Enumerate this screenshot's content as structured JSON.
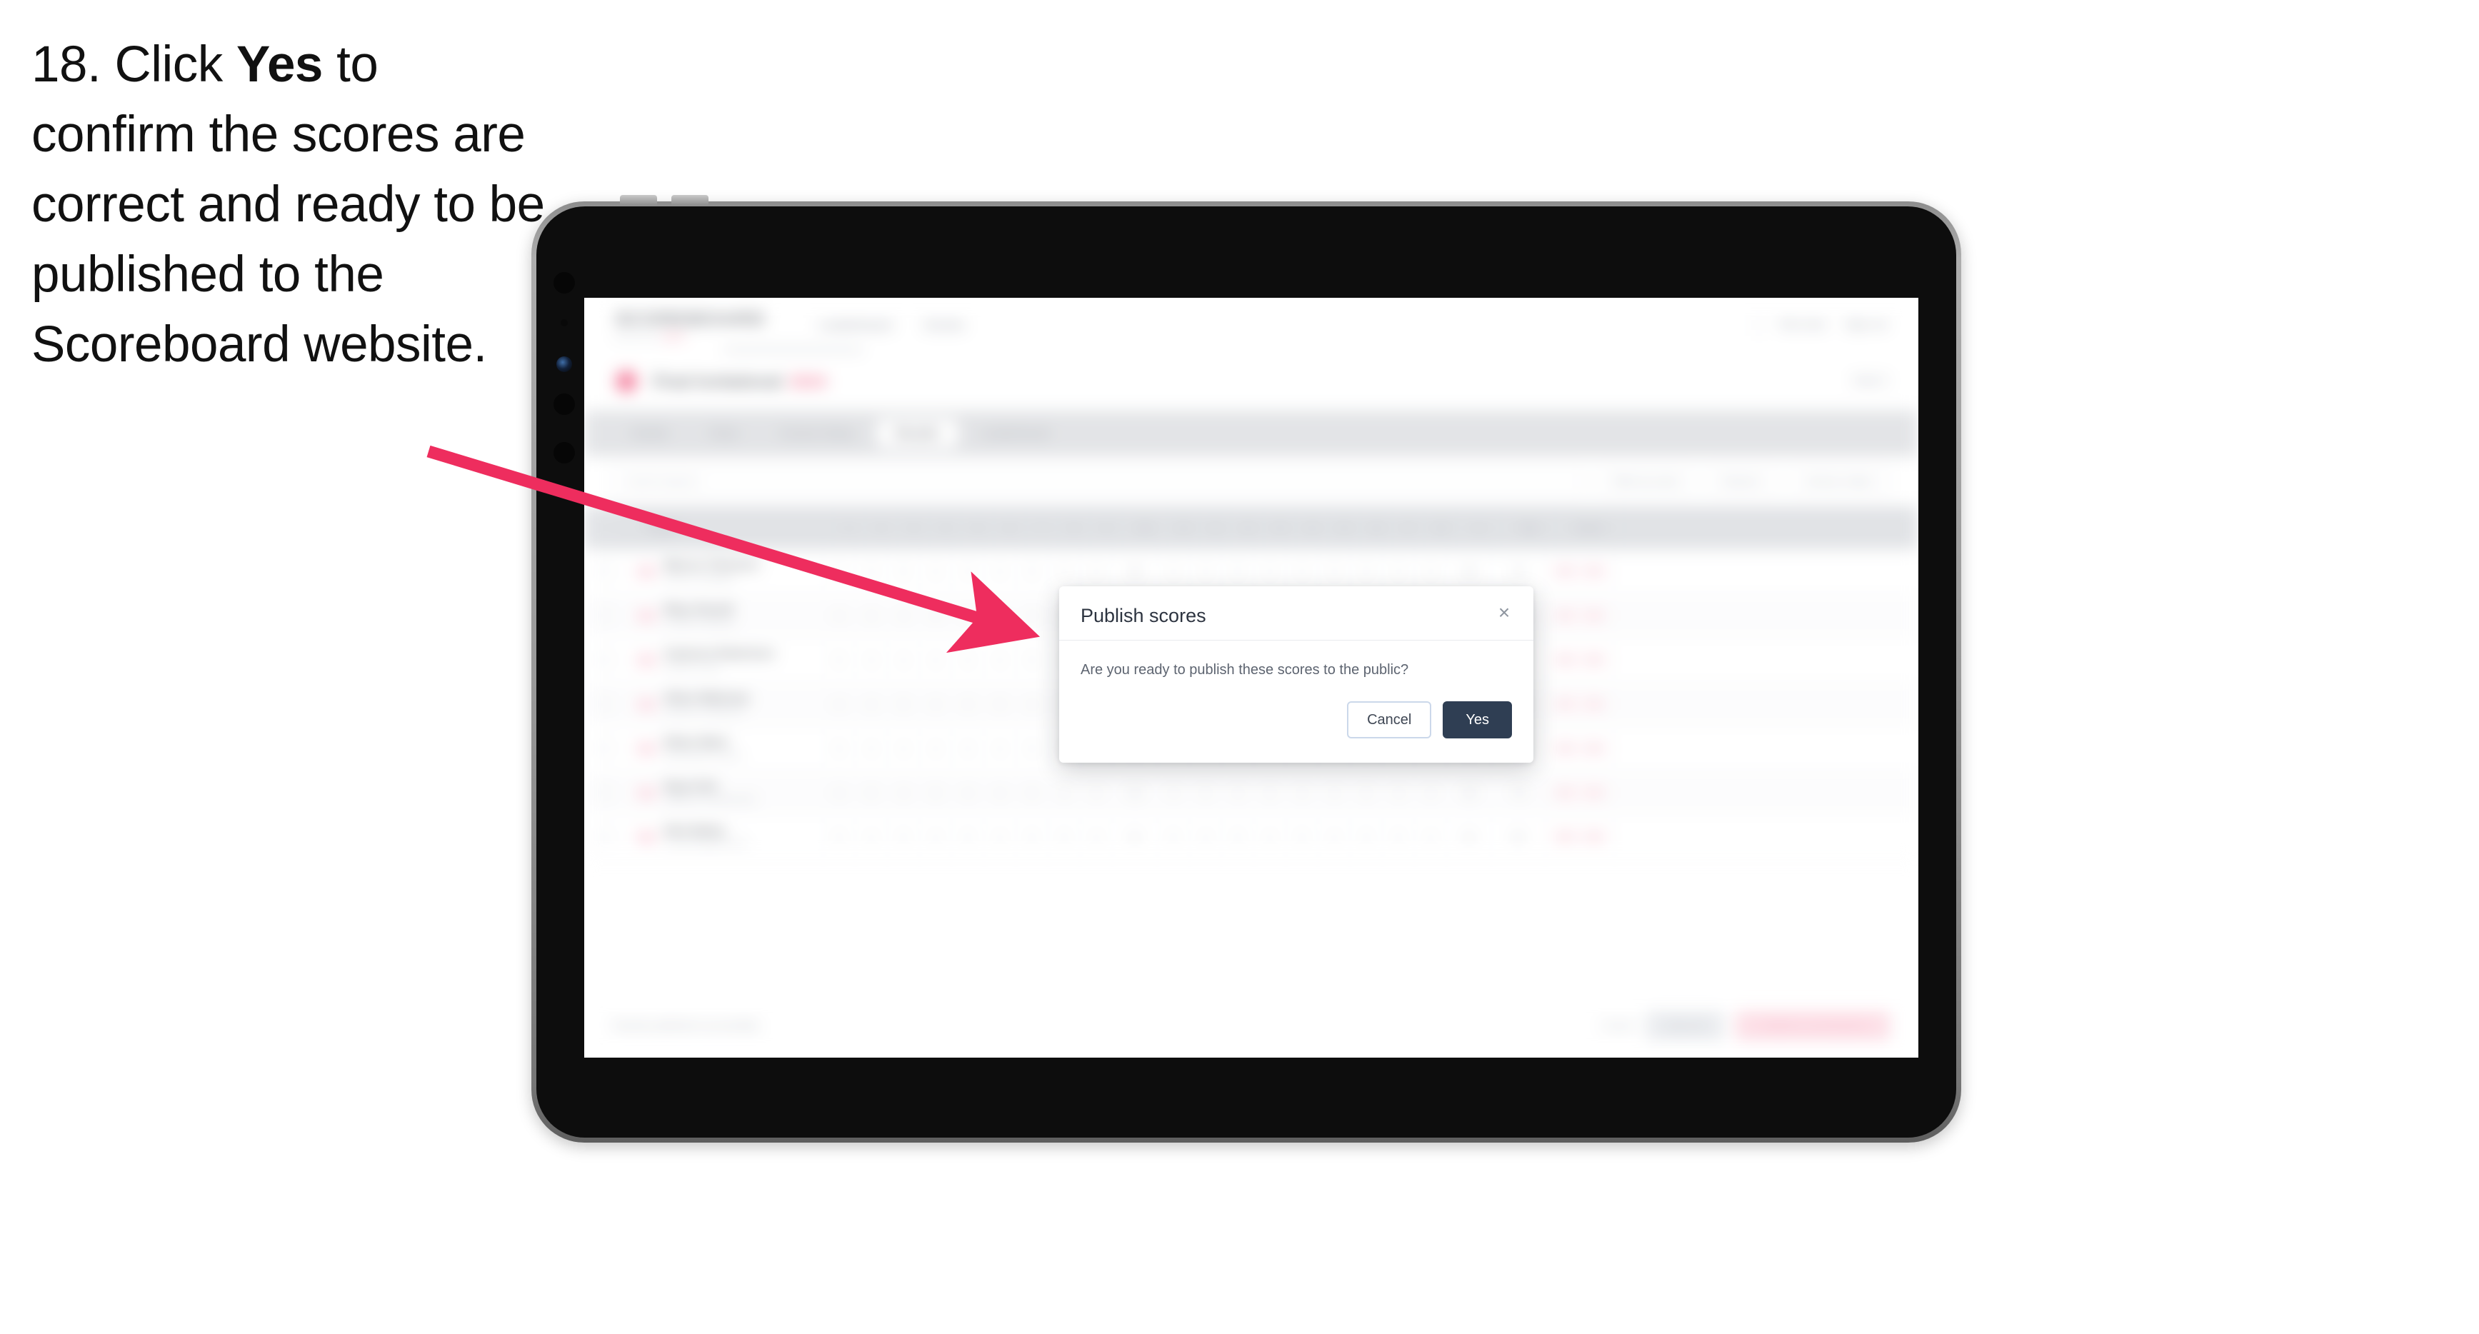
{
  "instruction": {
    "number": "18.",
    "pre": "Click ",
    "emph": "Yes",
    "post": " to confirm the scores are correct and ready to be published to the Scoreboard website."
  },
  "colors": {
    "arrow": "#ee2d5e",
    "accent": "#ee3a68",
    "primary_button": "#2f3e53",
    "tablet_frame": "#9a9a9a",
    "tablet_body": "#0d0d0d"
  },
  "app": {
    "brand": {
      "word": "SCOREBOARD",
      "tagline_pre": "powered by ",
      "tagline_accent": "sport"
    },
    "nav": [
      "Leaderboard",
      "Events"
    ],
    "header_right": [
      "Test User",
      "Sign out"
    ],
    "competition": {
      "title": "Final Invitational",
      "year": "2024",
      "right_label": "Heat 3"
    },
    "tabs": [
      {
        "label": "Details",
        "active": false
      },
      {
        "label": "Draw",
        "active": false
      },
      {
        "label": "Course Setup",
        "active": false
      },
      {
        "label": "Results",
        "active": true
      },
      {
        "label": "Leaderboard",
        "active": false
      }
    ],
    "filters": {
      "search_placeholder": "Search players",
      "buttons": [
        "Filter by event",
        "Round 1",
        "Sort by: Name"
      ]
    },
    "table": {
      "columns": [
        "Player",
        "1",
        "2",
        "3",
        "4",
        "5",
        "6",
        "7",
        "8",
        "9",
        "Out",
        "10",
        "11",
        "12",
        "13",
        "14",
        "15",
        "16",
        "17",
        "18",
        "In",
        "Total",
        "Actions"
      ],
      "rows": [
        {
          "name": "Marcus Thomson",
          "team": "Eastern Collegiate",
          "scores": [
            "4",
            "3",
            "5",
            "4",
            "3",
            "4",
            "5",
            "4",
            "4",
            "36",
            "4",
            "3",
            "5",
            "4",
            "4",
            "3",
            "5",
            "4",
            "4",
            "36",
            "72"
          ],
          "actions": [
            "Edit",
            "Void"
          ]
        },
        {
          "name": "Rhys Parnell",
          "team": "Coastal Challenge",
          "scores": [
            "4",
            "4",
            "4",
            "5",
            "3",
            "4",
            "4",
            "5",
            "4",
            "37",
            "4",
            "4",
            "4",
            "5",
            "3",
            "4",
            "4",
            "5",
            "4",
            "37",
            "74"
          ],
          "actions": [
            "Edit",
            "Void"
          ]
        },
        {
          "name": "Cameron Robertson",
          "team": "Northern Open",
          "scores": [
            "5",
            "3",
            "4",
            "4",
            "4",
            "4",
            "5",
            "4",
            "5",
            "38",
            "5",
            "3",
            "4",
            "4",
            "4",
            "4",
            "5",
            "4",
            "4",
            "37",
            "75"
          ],
          "actions": [
            "Edit",
            "Void"
          ]
        },
        {
          "name": "Oliver Mahoney",
          "team": "Southern Invitational",
          "scores": [
            "4",
            "4",
            "5",
            "4",
            "3",
            "5",
            "4",
            "4",
            "5",
            "38",
            "4",
            "4",
            "5",
            "4",
            "3",
            "5",
            "4",
            "4",
            "5",
            "38",
            "76"
          ],
          "actions": [
            "Edit",
            "Void"
          ]
        },
        {
          "name": "Ethan Ward",
          "team": "Metropolitan Classic",
          "scores": [
            "5",
            "4",
            "4",
            "4",
            "4",
            "4",
            "5",
            "5",
            "4",
            "39",
            "5",
            "4",
            "4",
            "4",
            "4",
            "4",
            "5",
            "5",
            "4",
            "39",
            "78"
          ],
          "actions": [
            "Edit",
            "Void"
          ]
        },
        {
          "name": "Ryan Kirk",
          "team": "Highland Championship",
          "scores": [
            "4",
            "5",
            "4",
            "5",
            "4",
            "4",
            "5",
            "4",
            "5",
            "40",
            "4",
            "5",
            "4",
            "5",
            "4",
            "4",
            "5",
            "4",
            "4",
            "39",
            "79"
          ],
          "actions": [
            "Edit",
            "Void"
          ]
        },
        {
          "name": "Nick Bailey",
          "team": "Central Regional Cup",
          "scores": [
            "5",
            "4",
            "5",
            "4",
            "5",
            "4",
            "5",
            "5",
            "4",
            "41",
            "5",
            "4",
            "5",
            "4",
            "5",
            "4",
            "5",
            "5",
            "4",
            "41",
            "82"
          ],
          "actions": [
            "Edit",
            "Void"
          ]
        }
      ]
    },
    "footer": {
      "note": "Results published successfully.",
      "link_label": "Cancel",
      "secondary_label": "Save all",
      "primary_label": "Publish to Scoreboard"
    }
  },
  "modal": {
    "title": "Publish scores",
    "message": "Are you ready to publish these scores to the public?",
    "cancel_label": "Cancel",
    "confirm_label": "Yes",
    "close_icon": "×"
  }
}
